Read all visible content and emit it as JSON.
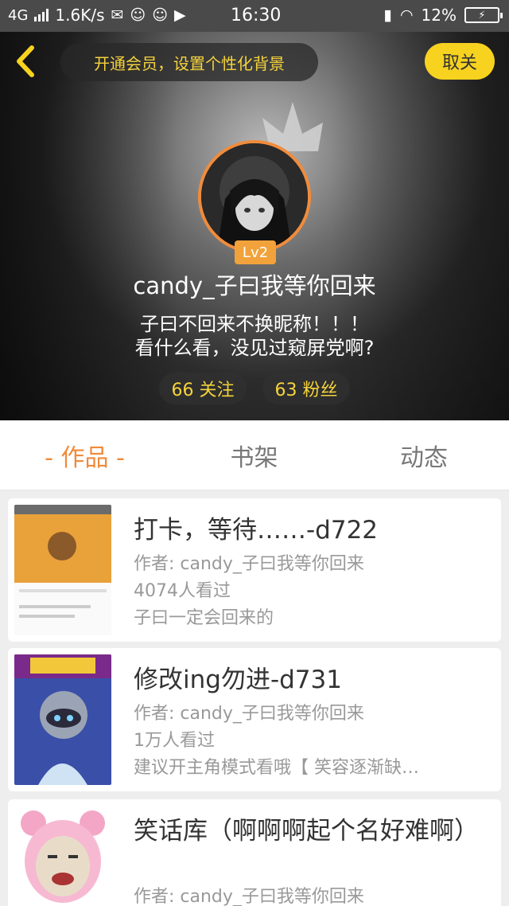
{
  "status_bar": {
    "network": "4G",
    "speed": "1.6K/s",
    "time": "16:30",
    "battery": "12%",
    "icons": [
      "signal-icon",
      "wechat-icon",
      "qq-icon",
      "qq-icon",
      "video-icon",
      "sim-icon",
      "wifi-icon",
      "battery-icon"
    ]
  },
  "header": {
    "vip_prompt": "开通会员，设置个性化背景",
    "follow_label": "取关",
    "level": "Lv2",
    "username": "candy_子曰我等你回来",
    "bio_line1": "子曰不回来不换昵称！！！",
    "bio_line2": "看什么看，没见过窥屏党啊?",
    "following": "66 关注",
    "fans": "63 粉丝"
  },
  "tabs": [
    {
      "label": "- 作品 -",
      "active": true
    },
    {
      "label": "书架",
      "active": false
    },
    {
      "label": "动态",
      "active": false
    }
  ],
  "works": [
    {
      "title": "打卡，等待……-d722",
      "author": "作者: candy_子曰我等你回来",
      "views": "4074人看过",
      "desc": "子曰一定会回来的"
    },
    {
      "title": "修改ing勿进-d731",
      "author": "作者: candy_子曰我等你回来",
      "views": "1万人看过",
      "desc": "建议开主角模式看哦【 笑容逐渐缺…"
    },
    {
      "title": "笑话库（啊啊啊起个名好难啊）",
      "author": "作者: candy_子曰我等你回来"
    }
  ],
  "colors": {
    "accent_orange": "#f08a3a",
    "accent_yellow": "#f7d21f",
    "vip_text": "#f5d33c"
  }
}
